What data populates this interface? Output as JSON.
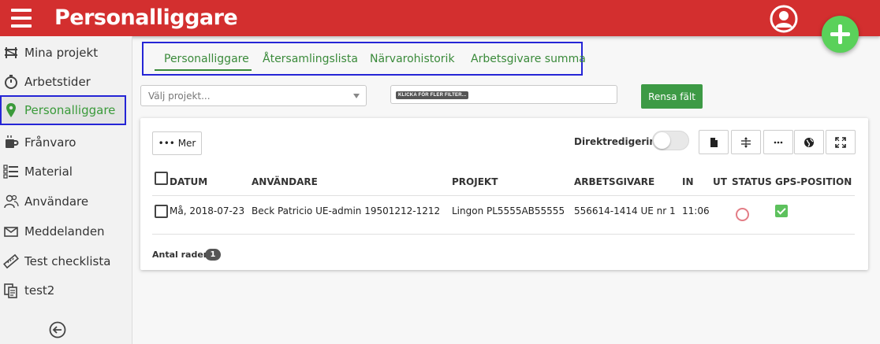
{
  "header": {
    "title": "Personalliggare"
  },
  "sidebar": {
    "items": [
      {
        "label": "Mina projekt"
      },
      {
        "label": "Arbetstider"
      },
      {
        "label": "Personalliggare"
      },
      {
        "label": "Frånvaro"
      },
      {
        "label": "Material"
      },
      {
        "label": "Användare"
      },
      {
        "label": "Meddelanden"
      },
      {
        "label": "Test checklista"
      },
      {
        "label": "test2"
      }
    ]
  },
  "tabs": [
    {
      "label": "Personalliggare",
      "active": true
    },
    {
      "label": "Återsamlingslista"
    },
    {
      "label": "Närvarohistorik"
    },
    {
      "label": "Arbetsgivare summa"
    }
  ],
  "filters": {
    "project_placeholder": "Välj projekt...",
    "more_filters_tag": "KLICKA FÖR FLER FILTER...",
    "clear_label": "Rensa fält"
  },
  "toolbar": {
    "more_label": "••• Mer",
    "direct_edit_label": "Direktredigering",
    "direct_edit_on": false,
    "icons": [
      "file-icon",
      "row-height-icon",
      "more-dots-icon",
      "globe-icon",
      "fullscreen-icon"
    ]
  },
  "table": {
    "columns": [
      "DATUM",
      "ANVÄNDARE",
      "PROJEKT",
      "ARBETSGIVARE",
      "IN",
      "UT",
      "STATUS",
      "GPS-POSITION"
    ],
    "rows": [
      {
        "datum": "Må, 2018-07-23",
        "anvandare": "Beck Patricio UE-admin 19501212-1212",
        "projekt": "Lingon PL5555AB55555",
        "arbetsgivare": "556614-1414 UE nr 1",
        "in": "11:06",
        "ut": "",
        "status": "unchecked",
        "gps": "checked"
      }
    ],
    "row_count_label": "Antal rader:",
    "row_count": "1"
  },
  "colors": {
    "header_bg": "#d32f2f",
    "accent_green": "#3a8a3a",
    "fab_green": "#5ad15a",
    "clear_button": "#3d9a45",
    "highlight_outline": "#2525d6"
  }
}
